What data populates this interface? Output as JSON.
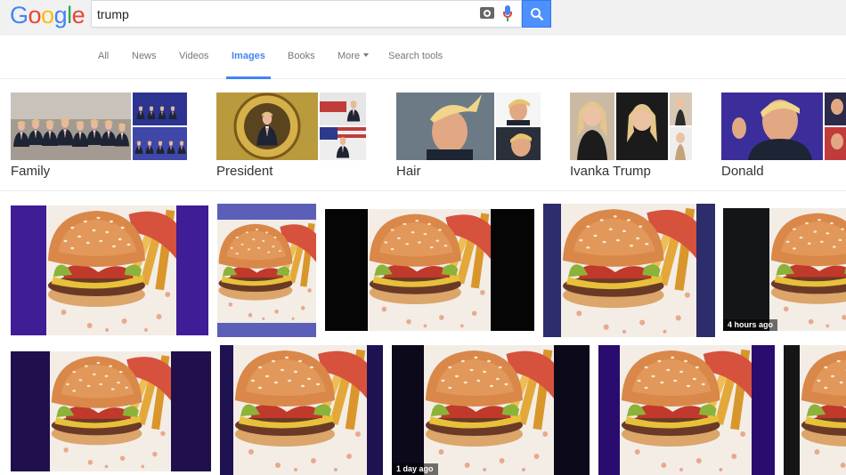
{
  "logo": "Google",
  "search": {
    "query": "trump"
  },
  "icons": {
    "camera": "camera-icon",
    "mic": "mic-icon",
    "search": "search-icon"
  },
  "tabs": [
    {
      "label": "All"
    },
    {
      "label": "News"
    },
    {
      "label": "Videos"
    },
    {
      "label": "Images"
    },
    {
      "label": "Books"
    },
    {
      "label": "More"
    },
    {
      "label": "Search tools"
    }
  ],
  "related": [
    {
      "label": "Family"
    },
    {
      "label": "President"
    },
    {
      "label": "Hair"
    },
    {
      "label": "Ivanka Trump"
    },
    {
      "label": "Donald"
    }
  ],
  "results": {
    "badge_row1": "4 hours ago",
    "badge_row2": "1 day ago"
  },
  "colors": {
    "accent": "#4285f4",
    "search_button": "#4d90fe",
    "topbar": "#f1f1f1"
  }
}
